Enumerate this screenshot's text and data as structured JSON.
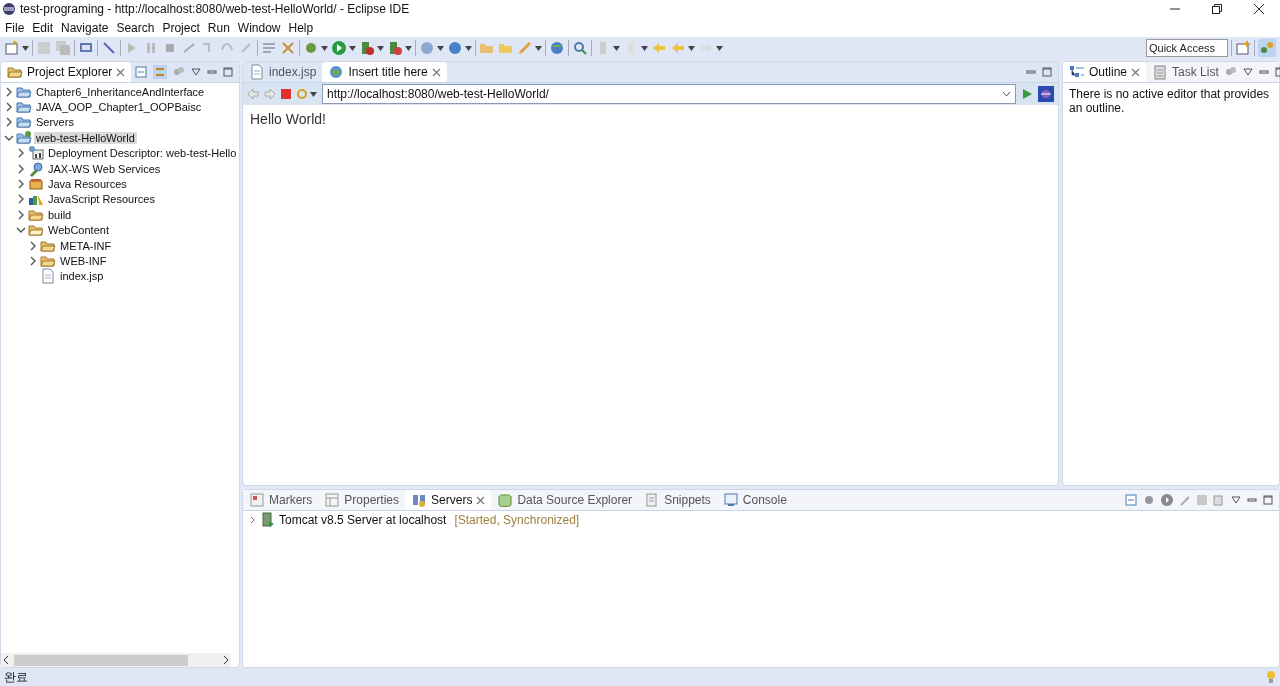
{
  "window": {
    "title": "test-programing - http://localhost:8080/web-test-HelloWorld/ - Eclipse IDE"
  },
  "menu": [
    "File",
    "Edit",
    "Navigate",
    "Search",
    "Project",
    "Run",
    "Window",
    "Help"
  ],
  "quick_access": {
    "placeholder": "Quick Access"
  },
  "project_explorer": {
    "tabs": [
      {
        "label": "Project Explorer",
        "selected": true
      }
    ],
    "tree": [
      {
        "label": "Chapter6_InheritanceAndInterface",
        "kind": "project",
        "expanded": false,
        "selected": false
      },
      {
        "label": "JAVA_OOP_Chapter1_OOPBaisc",
        "kind": "project",
        "expanded": false,
        "selected": false
      },
      {
        "label": "Servers",
        "kind": "project",
        "expanded": false,
        "selected": false
      },
      {
        "label": "web-test-HelloWorld",
        "kind": "webproject",
        "expanded": true,
        "selected": true,
        "children": [
          {
            "label": "Deployment Descriptor: web-test-Hello",
            "kind": "descriptor",
            "expanded": false,
            "selected": false
          },
          {
            "label": "JAX-WS Web Services",
            "kind": "webservice",
            "expanded": false,
            "selected": false
          },
          {
            "label": "Java Resources",
            "kind": "javares",
            "expanded": false,
            "selected": false
          },
          {
            "label": "JavaScript Resources",
            "kind": "jsres",
            "expanded": false,
            "selected": false
          },
          {
            "label": "build",
            "kind": "folder",
            "expanded": false,
            "selected": false
          },
          {
            "label": "WebContent",
            "kind": "folder",
            "expanded": true,
            "selected": false,
            "children": [
              {
                "label": "META-INF",
                "kind": "folder",
                "expanded": false,
                "selected": false
              },
              {
                "label": "WEB-INF",
                "kind": "folder",
                "expanded": false,
                "selected": false
              },
              {
                "label": "index.jsp",
                "kind": "file",
                "selected": false
              }
            ]
          }
        ]
      }
    ]
  },
  "editor": {
    "tabs": [
      {
        "label": "index.jsp",
        "kind": "file",
        "selected": false
      },
      {
        "label": "Insert title here",
        "kind": "web",
        "selected": true
      }
    ],
    "url": "http://localhost:8080/web-test-HelloWorld/",
    "content": "Hello World!"
  },
  "outline": {
    "tabs": [
      {
        "label": "Outline",
        "kind": "outline",
        "selected": true
      },
      {
        "label": "Task List",
        "kind": "tasks",
        "selected": false
      }
    ],
    "message": "There is no active editor that provides an outline."
  },
  "bottom": {
    "tabs": [
      {
        "label": "Markers",
        "kind": "markers",
        "selected": false
      },
      {
        "label": "Properties",
        "kind": "properties",
        "selected": false
      },
      {
        "label": "Servers",
        "kind": "servers",
        "selected": true
      },
      {
        "label": "Data Source Explorer",
        "kind": "datasource",
        "selected": false
      },
      {
        "label": "Snippets",
        "kind": "snippets",
        "selected": false
      },
      {
        "label": "Console",
        "kind": "console",
        "selected": false
      }
    ],
    "servers": [
      {
        "name": "Tomcat v8.5 Server at localhost",
        "status": "[Started, Synchronized]",
        "expanded": false
      }
    ]
  },
  "status_bar": {
    "text": "완료"
  }
}
